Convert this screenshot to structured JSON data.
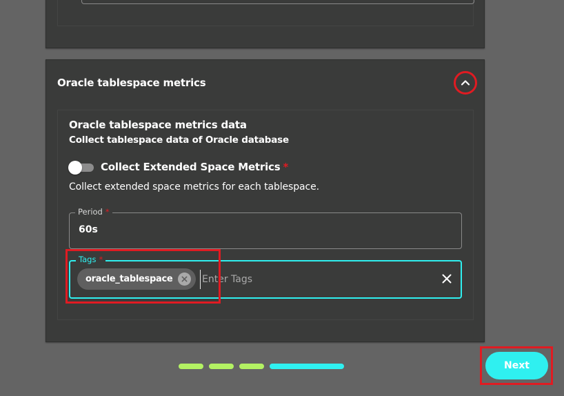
{
  "panel": {
    "title": "Oracle tablespace metrics"
  },
  "section": {
    "title": "Oracle tablespace metrics data",
    "subtitle": "Collect tablespace data of Oracle database",
    "toggle_label": "Collect Extended Space Metrics",
    "toggle_required": "*",
    "toggle_description": "Collect extended space metrics for each tablespace.",
    "toggle_on": false
  },
  "period": {
    "label": "Period",
    "required": "*",
    "value": "60s"
  },
  "tags": {
    "label": "Tags",
    "required": "*",
    "chips": [
      "oracle_tablespace"
    ],
    "placeholder": "Enter Tags"
  },
  "footer": {
    "next_label": "Next",
    "steps_total": 4,
    "current_step": 4
  },
  "colors": {
    "accent": "#2ff0f0",
    "step_done": "#b3f263",
    "highlight": "#e01b22",
    "required": "#e01b22"
  },
  "icons": {
    "collapse": "chevron-up-icon",
    "chip_remove": "close-circle-icon",
    "clear": "close-icon"
  }
}
